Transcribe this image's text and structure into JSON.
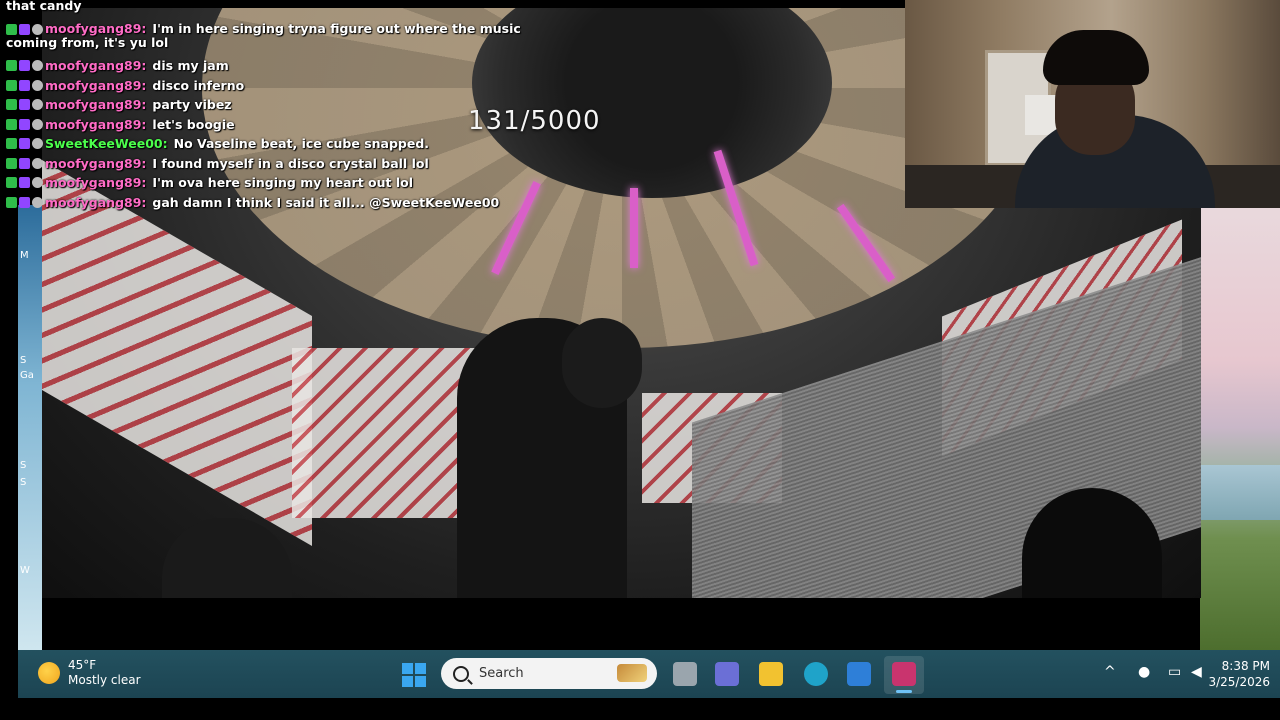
{
  "game": {
    "counter": "131/5000"
  },
  "chat": {
    "partial_top": "that candy",
    "messages": [
      {
        "user": "moofygang89:",
        "text": "I'm in here singing tryna figure out where the music coming from, it's yu lol",
        "color": "#ff6cc6"
      },
      {
        "user": "moofygang89:",
        "text": "dis my jam",
        "color": "#ff6cc6"
      },
      {
        "user": "moofygang89:",
        "text": "disco inferno",
        "color": "#ff6cc6"
      },
      {
        "user": "moofygang89:",
        "text": "party vibez",
        "color": "#ff6cc6"
      },
      {
        "user": "moofygang89:",
        "text": "let's boogie",
        "color": "#ff6cc6"
      },
      {
        "user": "SweetKeeWee00:",
        "text": "No Vaseline beat, ice cube snapped.",
        "color": "#4cff4c"
      },
      {
        "user": "moofygang89:",
        "text": "I found myself in a disco crystal ball lol",
        "color": "#ff6cc6"
      },
      {
        "user": "moofygang89:",
        "text": "I'm ova here singing my heart out lol",
        "color": "#ff6cc6"
      },
      {
        "user": "moofygang89:",
        "text": "gah damn I think I said it all... @SweetKeeWee00",
        "color": "#ff6cc6"
      }
    ]
  },
  "desktop": {
    "icon_labels": [
      "M",
      "S",
      "Ga",
      "S",
      "S",
      "W"
    ]
  },
  "taskbar": {
    "weather": {
      "temp": "45°F",
      "condition": "Mostly clear",
      "icon": "sun-icon"
    },
    "search_label": "Search",
    "apps": [
      {
        "name": "task-view-icon",
        "color": "#9aa5ad"
      },
      {
        "name": "teams-icon",
        "color": "#6b6fd6"
      },
      {
        "name": "file-explorer-icon",
        "color": "#f2c230"
      },
      {
        "name": "edge-icon",
        "color": "#1fa3c9"
      },
      {
        "name": "store-icon",
        "color": "#2e7fd8"
      },
      {
        "name": "affinity-icon",
        "color": "#c2185b"
      }
    ],
    "time": "8:38 PM",
    "date": "3/25/2026"
  }
}
